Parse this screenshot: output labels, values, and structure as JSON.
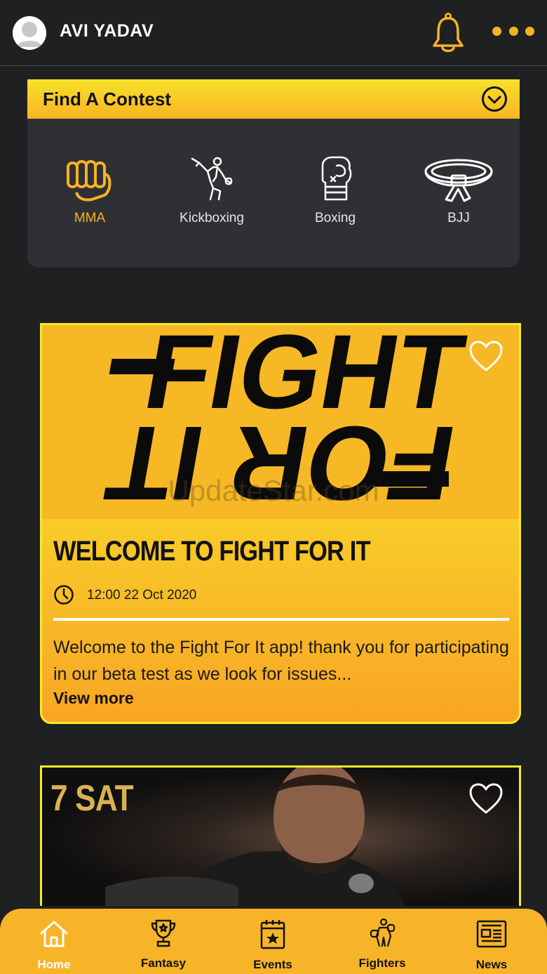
{
  "header": {
    "username": "AVI YADAV",
    "avatar_icon": "user-avatar-icon",
    "notification_icon": "bell-icon",
    "menu_icon": "more-dots-icon"
  },
  "contest": {
    "title": "Find A Contest",
    "toggle_icon": "chevron-down-circle-icon",
    "sports": [
      {
        "label": "MMA",
        "icon": "fist-icon",
        "active": true
      },
      {
        "label": "Kickboxing",
        "icon": "kickboxer-icon",
        "active": false
      },
      {
        "label": "Boxing",
        "icon": "boxing-glove-icon",
        "active": false
      },
      {
        "label": "BJJ",
        "icon": "belt-icon",
        "active": false
      }
    ]
  },
  "feed": [
    {
      "image_text": [
        "FIGHT",
        "FOR IT"
      ],
      "watermark": "UpdateStar.com",
      "title": "WELCOME TO FIGHT FOR IT",
      "time": "12:00 22 Oct 2020",
      "description": "Welcome to the Fight For It app!  thank you for participating in our beta test as we look for issues...",
      "more_label": "View more",
      "favorite_icon": "heart-outline-icon"
    },
    {
      "image_text": "7 SAT",
      "favorite_icon": "heart-outline-icon"
    }
  ],
  "colors": {
    "background": "#1f2022",
    "accent": "#f5b324",
    "card_top": "#f7f12e",
    "card_bottom": "#f8a524",
    "nav": "#f8b428"
  },
  "bottom_nav": [
    {
      "label": "Home",
      "icon": "home-icon",
      "active": true
    },
    {
      "label": "Fantasy",
      "icon": "trophy-icon",
      "active": false
    },
    {
      "label": "Events",
      "icon": "calendar-star-icon",
      "active": false
    },
    {
      "label": "Fighters",
      "icon": "fighter-icon",
      "active": false
    },
    {
      "label": "News",
      "icon": "newspaper-icon",
      "active": false
    }
  ]
}
